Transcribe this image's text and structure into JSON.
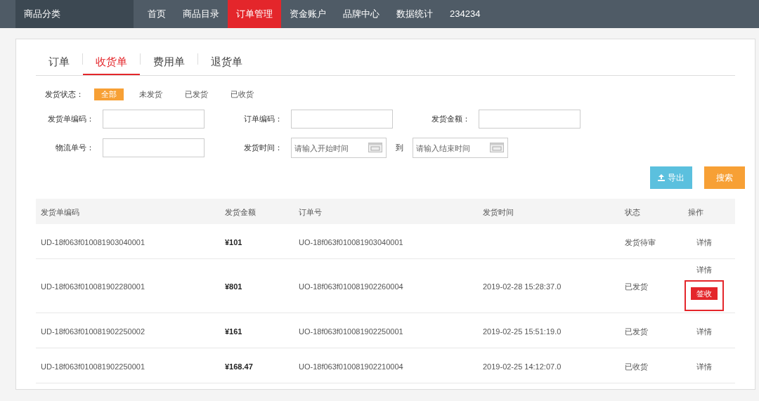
{
  "nav": {
    "category": "商品分类",
    "items": [
      {
        "label": "首页",
        "selected": false
      },
      {
        "label": "商品目录",
        "selected": false
      },
      {
        "label": "订单管理",
        "selected": true
      },
      {
        "label": "资金账户",
        "selected": false
      },
      {
        "label": "品牌中心",
        "selected": false
      },
      {
        "label": "数据统计",
        "selected": false
      },
      {
        "label": "234234",
        "selected": false
      }
    ]
  },
  "tabs": [
    {
      "label": "订单",
      "selected": false
    },
    {
      "label": "收货单",
      "selected": true
    },
    {
      "label": "费用单",
      "selected": false
    },
    {
      "label": "退货单",
      "selected": false
    }
  ],
  "filters": {
    "status_label": "发货状态：",
    "status_options": [
      {
        "label": "全部",
        "selected": true
      },
      {
        "label": "未发货",
        "selected": false
      },
      {
        "label": "已发货",
        "selected": false
      },
      {
        "label": "已收货",
        "selected": false
      }
    ],
    "shipment_code": {
      "label": "发货单编码："
    },
    "order_code": {
      "label": "订单编码："
    },
    "amount": {
      "label": "发货金额："
    },
    "tracking_no": {
      "label": "物流单号："
    },
    "ship_time": {
      "label": "发货时间：",
      "start_placeholder": "请输入开始时间",
      "to": "到",
      "end_placeholder": "请输入结束时间"
    }
  },
  "buttons": {
    "export": "导出",
    "search": "搜索"
  },
  "table": {
    "columns": [
      "发货单编码",
      "发货金额",
      "订单号",
      "发货时间",
      "状态",
      "操作"
    ],
    "rows": [
      {
        "code": "UD-18f063f010081903040001",
        "amount": "¥101",
        "order": "UO-18f063f010081903040001",
        "time": "",
        "status": "发货待审",
        "actions": [
          {
            "kind": "link",
            "label": "详情",
            "highlighted": false
          }
        ]
      },
      {
        "code": "UD-18f063f010081902280001",
        "amount": "¥801",
        "order": "UO-18f063f010081902260004",
        "time": "2019-02-28 15:28:37.0",
        "status": "已发货",
        "actions": [
          {
            "kind": "link",
            "label": "详情",
            "highlighted": false
          },
          {
            "kind": "button",
            "label": "签收",
            "highlighted": true
          }
        ]
      },
      {
        "code": "UD-18f063f010081902250002",
        "amount": "¥161",
        "order": "UO-18f063f010081902250001",
        "time": "2019-02-25 15:51:19.0",
        "status": "已发货",
        "actions": [
          {
            "kind": "link",
            "label": "详情",
            "highlighted": false
          }
        ]
      },
      {
        "code": "UD-18f063f010081902250001",
        "amount": "¥168.47",
        "order": "UO-18f063f010081902210004",
        "time": "2019-02-25 14:12:07.0",
        "status": "已收货",
        "actions": [
          {
            "kind": "link",
            "label": "详情",
            "highlighted": false
          }
        ]
      }
    ]
  }
}
